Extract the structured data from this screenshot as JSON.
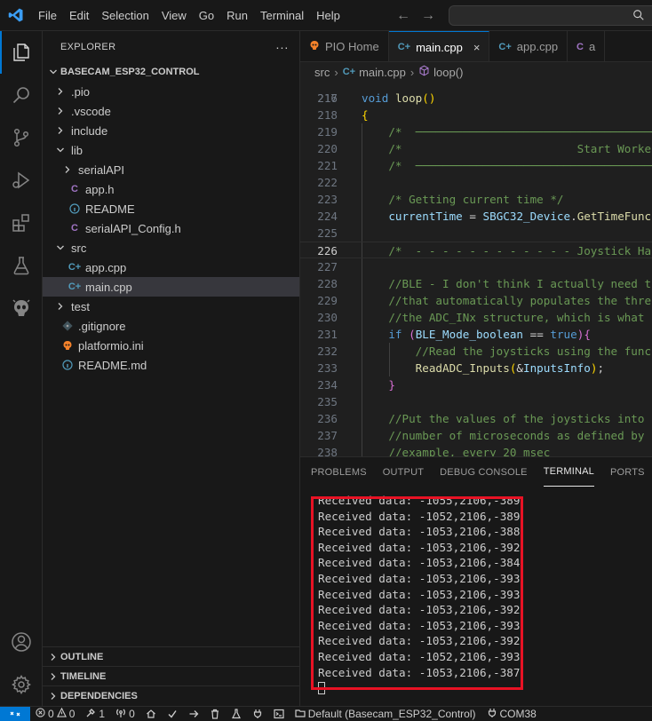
{
  "menu": [
    "File",
    "Edit",
    "Selection",
    "View",
    "Go",
    "Run",
    "Terminal",
    "Help"
  ],
  "explorer": {
    "header": "EXPLORER",
    "more": "···",
    "project": "BASECAM_ESP32_CONTROL",
    "tree": [
      {
        "label": ".pio",
        "kind": "folder",
        "open": false,
        "indent": 1
      },
      {
        "label": ".vscode",
        "kind": "folder",
        "open": false,
        "indent": 1
      },
      {
        "label": "include",
        "kind": "folder",
        "open": false,
        "indent": 1
      },
      {
        "label": "lib",
        "kind": "folder",
        "open": true,
        "indent": 1
      },
      {
        "label": "serialAPI",
        "kind": "folder",
        "open": false,
        "indent": 2
      },
      {
        "label": "app.h",
        "kind": "c",
        "indent": 2
      },
      {
        "label": "README",
        "kind": "info",
        "indent": 2
      },
      {
        "label": "serialAPI_Config.h",
        "kind": "c",
        "indent": 2
      },
      {
        "label": "src",
        "kind": "folder",
        "open": true,
        "indent": 1
      },
      {
        "label": "app.cpp",
        "kind": "cpp",
        "indent": 2
      },
      {
        "label": "main.cpp",
        "kind": "cpp",
        "indent": 2,
        "selected": true
      },
      {
        "label": "test",
        "kind": "folder",
        "open": false,
        "indent": 1
      },
      {
        "label": ".gitignore",
        "kind": "git",
        "indent": 1
      },
      {
        "label": "platformio.ini",
        "kind": "pio",
        "indent": 1
      },
      {
        "label": "README.md",
        "kind": "info",
        "indent": 1
      }
    ],
    "sections": [
      "OUTLINE",
      "TIMELINE",
      "DEPENDENCIES"
    ]
  },
  "tabs": [
    {
      "label": "PIO Home",
      "icon": "pio"
    },
    {
      "label": "main.cpp",
      "icon": "cpp",
      "active": true,
      "close": "×"
    },
    {
      "label": "app.cpp",
      "icon": "cpp"
    },
    {
      "label": "a",
      "icon": "c"
    }
  ],
  "breadcrumb": {
    "folder": "src",
    "file": "main.cpp",
    "symbol": "loop()"
  },
  "editor": {
    "first_line_partial": "216",
    "current_line": "226",
    "lines": [
      {
        "n": "217",
        "html": "<span class='c-kw'>void</span> <span class='c-fn'>loop</span><span class='c-br'>()</span>"
      },
      {
        "n": "218",
        "html": "<span class='c-br'>{</span>"
      },
      {
        "n": "219",
        "html": "    <span class='c-cm'>/*  ──────────────────────────────────────────────</span>"
      },
      {
        "n": "220",
        "html": "    <span class='c-cm'>/*                          Start Worker</span>"
      },
      {
        "n": "221",
        "html": "    <span class='c-cm'>/*  ──────────────────────────────────────────────</span>"
      },
      {
        "n": "222",
        "html": ""
      },
      {
        "n": "223",
        "html": "    <span class='c-cm'>/* Getting current time */</span>"
      },
      {
        "n": "224",
        "html": "    <span class='c-var'>currentTime</span> <span class='c-op'>=</span> <span class='c-var'>SBGC32_Device</span>.<span class='c-fn'>GetTimeFunc</span>"
      },
      {
        "n": "225",
        "html": ""
      },
      {
        "n": "226",
        "html": "    <span class='c-cm'>/*  - - - - - - - - - - - - Joystick Hand</span>"
      },
      {
        "n": "227",
        "html": ""
      },
      {
        "n": "228",
        "html": "    <span class='c-cm'>//BLE - I don't think I actually need t</span>"
      },
      {
        "n": "229",
        "html": "    <span class='c-cm'>//that automatically populates the thre</span>"
      },
      {
        "n": "230",
        "html": "    <span class='c-cm'>//the ADC_INx structure, which is what</span>"
      },
      {
        "n": "231",
        "html": "    <span class='c-kw'>if</span> <span class='c-br2'>(</span><span class='c-var'>BLE_Mode_boolean</span> <span class='c-op'>==</span> <span class='c-kw'>true</span><span class='c-br2'>){</span>"
      },
      {
        "n": "232",
        "html": "        <span class='c-cm'>//Read the joysticks using the func</span>"
      },
      {
        "n": "233",
        "html": "        <span class='c-fn'>ReadADC_Inputs</span><span class='c-br'>(</span><span class='c-op'>&amp;</span><span class='c-var'>InputsInfo</span><span class='c-br'>)</span>;"
      },
      {
        "n": "234",
        "html": "    <span class='c-br2'>}</span>"
      },
      {
        "n": "235",
        "html": ""
      },
      {
        "n": "236",
        "html": "    <span class='c-cm'>//Put the values of the joysticks into</span>"
      },
      {
        "n": "237",
        "html": "    <span class='c-cm'>//number of microseconds as defined by</span>"
      },
      {
        "n": "238",
        "html": "    <span class='c-cm'>//example, every 20 msec</span>"
      }
    ]
  },
  "panel": {
    "tabs": [
      "PROBLEMS",
      "OUTPUT",
      "DEBUG CONSOLE",
      "TERMINAL",
      "PORTS"
    ],
    "active_tab": "TERMINAL",
    "terminal_lines": [
      "Received data: -1055,2106,-389",
      "Received data: -1052,2106,-389",
      "Received data: -1053,2106,-388",
      "Received data: -1053,2106,-392",
      "Received data: -1053,2106,-384",
      "Received data: -1053,2106,-393",
      "Received data: -1053,2106,-393",
      "Received data: -1053,2106,-392",
      "Received data: -1053,2106,-393",
      "Received data: -1053,2106,-392",
      "Received data: -1052,2106,-393",
      "Received data: -1053,2106,-387"
    ]
  },
  "status": {
    "errors": "0",
    "warnings": "0",
    "tests": "1",
    "ports": "0",
    "env": "Default (Basecam_ESP32_Control)",
    "port": "COM38"
  },
  "colors": {
    "accent": "#0078d4",
    "highlight": "#e81224"
  }
}
